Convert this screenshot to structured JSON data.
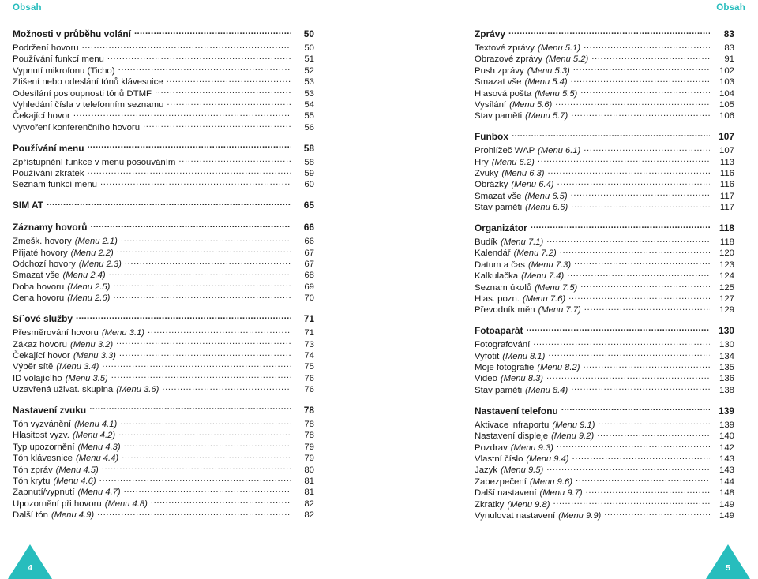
{
  "header": {
    "left_title": "Obsah",
    "right_title": "Obsah",
    "accent_color": "#27bdbd"
  },
  "footer": {
    "left_page": "4",
    "right_page": "5"
  },
  "left_column": {
    "groups": [
      {
        "section": {
          "label": "Možnosti v průběhu volání",
          "page": "50"
        },
        "entries": [
          {
            "label": "Podržení hovoru",
            "menu": "",
            "page": "50"
          },
          {
            "label": "Používání funkcí menu",
            "menu": "",
            "page": "51"
          },
          {
            "label": "Vypnutí mikrofonu (Ticho)",
            "menu": "",
            "page": "52"
          },
          {
            "label": "Ztišení nebo odeslání tónů klávesnice",
            "menu": "",
            "page": "53"
          },
          {
            "label": "Odesílání posloupnosti tónů DTMF",
            "menu": "",
            "page": "53"
          },
          {
            "label": "Vyhledání čísla v telefonním seznamu",
            "menu": "",
            "page": "54"
          },
          {
            "label": "Čekající hovor",
            "menu": "",
            "page": "55"
          },
          {
            "label": "Vytvoření konferenčního hovoru",
            "menu": "",
            "page": "56"
          }
        ]
      },
      {
        "section": {
          "label": "Používání menu",
          "page": "58"
        },
        "entries": [
          {
            "label": "Zpřístupnění funkce v menu posouváním",
            "menu": "",
            "page": "58"
          },
          {
            "label": "Používání zkratek",
            "menu": "",
            "page": "59"
          },
          {
            "label": "Seznam funkcí menu",
            "menu": "",
            "page": "60"
          }
        ]
      },
      {
        "section": {
          "label": "SIM AT",
          "page": "65"
        },
        "entries": []
      },
      {
        "section": {
          "label": "Záznamy hovorů",
          "page": "66"
        },
        "entries": [
          {
            "label": "Zmešk. hovory",
            "menu": "(Menu 2.1)",
            "page": "66"
          },
          {
            "label": "Přijaté hovory",
            "menu": "(Menu 2.2)",
            "page": "67"
          },
          {
            "label": "Odchozí hovory",
            "menu": "(Menu 2.3)",
            "page": "67"
          },
          {
            "label": "Smazat vše",
            "menu": "(Menu 2.4)",
            "page": "68"
          },
          {
            "label": "Doba hovoru",
            "menu": "(Menu 2.5)",
            "page": "69"
          },
          {
            "label": "Cena hovoru",
            "menu": "(Menu 2.6)",
            "page": "70"
          }
        ]
      },
      {
        "section": {
          "label": "Sí´ové služby",
          "page": "71"
        },
        "entries": [
          {
            "label": "Přesměrování hovoru",
            "menu": "(Menu 3.1)",
            "page": "71"
          },
          {
            "label": "Zákaz hovoru",
            "menu": "(Menu 3.2)",
            "page": "73"
          },
          {
            "label": "Čekající hovor",
            "menu": "(Menu 3.3)",
            "page": "74"
          },
          {
            "label": "Výběr sítě",
            "menu": "(Menu 3.4)",
            "page": "75"
          },
          {
            "label": "ID volajícího",
            "menu": "(Menu 3.5)",
            "page": "76"
          },
          {
            "label": "Uzavřená uživat. skupina",
            "menu": "(Menu 3.6)",
            "page": "76"
          }
        ]
      },
      {
        "section": {
          "label": "Nastavení zvuku",
          "page": "78"
        },
        "entries": [
          {
            "label": "Tón vyzvánění",
            "menu": "(Menu 4.1)",
            "page": "78"
          },
          {
            "label": "Hlasitost vyzv.",
            "menu": "(Menu 4.2)",
            "page": "78"
          },
          {
            "label": "Typ upozornění",
            "menu": "(Menu 4.3)",
            "page": "79"
          },
          {
            "label": "Tón klávesnice",
            "menu": "(Menu 4.4)",
            "page": "79"
          },
          {
            "label": "Tón zpráv",
            "menu": "(Menu 4.5)",
            "page": "80"
          },
          {
            "label": "Tón krytu",
            "menu": "(Menu 4.6)",
            "page": "81"
          },
          {
            "label": "Zapnutí/vypnutí",
            "menu": "(Menu 4.7)",
            "page": "81"
          },
          {
            "label": "Upozornění při hovoru",
            "menu": "(Menu 4.8)",
            "page": "82"
          },
          {
            "label": "Další tón",
            "menu": "(Menu 4.9)",
            "page": "82"
          }
        ]
      }
    ]
  },
  "right_column": {
    "groups": [
      {
        "section": {
          "label": "Zprávy",
          "page": "83"
        },
        "entries": [
          {
            "label": "Textové zprávy",
            "menu": "(Menu 5.1)",
            "page": "83"
          },
          {
            "label": "Obrazové zprávy",
            "menu": "(Menu 5.2)",
            "page": "91"
          },
          {
            "label": "Push zprávy",
            "menu": "(Menu 5.3)",
            "page": "102"
          },
          {
            "label": "Smazat vše",
            "menu": "(Menu 5.4)",
            "page": "103"
          },
          {
            "label": "Hlasová pošta",
            "menu": "(Menu 5.5)",
            "page": "104"
          },
          {
            "label": "Vysílání",
            "menu": "(Menu 5.6)",
            "page": "105"
          },
          {
            "label": "Stav paměti",
            "menu": "(Menu 5.7)",
            "page": "106"
          }
        ]
      },
      {
        "section": {
          "label": "Funbox",
          "page": "107"
        },
        "entries": [
          {
            "label": "Prohlížeč WAP",
            "menu": "(Menu 6.1)",
            "page": "107"
          },
          {
            "label": "Hry",
            "menu": "(Menu 6.2)",
            "page": "113"
          },
          {
            "label": "Zvuky",
            "menu": "(Menu 6.3)",
            "page": "116"
          },
          {
            "label": "Obrázky",
            "menu": "(Menu 6.4)",
            "page": "116"
          },
          {
            "label": "Smazat vše",
            "menu": "(Menu 6.5)",
            "page": "117"
          },
          {
            "label": "Stav paměti",
            "menu": "(Menu 6.6)",
            "page": "117"
          }
        ]
      },
      {
        "section": {
          "label": "Organizátor",
          "page": "118"
        },
        "entries": [
          {
            "label": "Budík",
            "menu": "(Menu 7.1)",
            "page": "118"
          },
          {
            "label": "Kalendář",
            "menu": "(Menu 7.2)",
            "page": "120"
          },
          {
            "label": "Datum a čas",
            "menu": "(Menu 7.3)",
            "page": "123"
          },
          {
            "label": "Kalkulačka",
            "menu": "(Menu 7.4)",
            "page": "124"
          },
          {
            "label": "Seznam úkolů",
            "menu": "(Menu 7.5)",
            "page": "125"
          },
          {
            "label": "Hlas. pozn.",
            "menu": "(Menu 7.6)",
            "page": "127"
          },
          {
            "label": "Převodník měn",
            "menu": "(Menu 7.7)",
            "page": "129"
          }
        ]
      },
      {
        "section": {
          "label": "Fotoaparát",
          "page": "130"
        },
        "entries": [
          {
            "label": "Fotografování",
            "menu": "",
            "page": "130"
          },
          {
            "label": "Vyfotit",
            "menu": "(Menu 8.1)",
            "page": "134"
          },
          {
            "label": "Moje fotografie",
            "menu": "(Menu 8.2)",
            "page": "135"
          },
          {
            "label": "Video",
            "menu": "(Menu 8.3)",
            "page": "136"
          },
          {
            "label": "Stav paměti",
            "menu": "(Menu 8.4)",
            "page": "138"
          }
        ]
      },
      {
        "section": {
          "label": "Nastavení telefonu",
          "page": "139"
        },
        "entries": [
          {
            "label": "Aktivace infraportu",
            "menu": "(Menu 9.1)",
            "page": "139"
          },
          {
            "label": "Nastavení displeje",
            "menu": "(Menu 9.2)",
            "page": "140"
          },
          {
            "label": "Pozdrav",
            "menu": "(Menu 9.3)",
            "page": "142"
          },
          {
            "label": "Vlastní číslo",
            "menu": "(Menu 9.4)",
            "page": "143"
          },
          {
            "label": "Jazyk",
            "menu": "(Menu 9.5)",
            "page": "143"
          },
          {
            "label": "Zabezpečení",
            "menu": "(Menu 9.6)",
            "page": "144"
          },
          {
            "label": "Další nastavení",
            "menu": "(Menu 9.7)",
            "page": "148"
          },
          {
            "label": "Zkratky",
            "menu": "(Menu 9.8)",
            "page": "149"
          },
          {
            "label": "Vynulovat nastavení",
            "menu": "(Menu 9.9)",
            "page": "149"
          }
        ]
      }
    ]
  }
}
